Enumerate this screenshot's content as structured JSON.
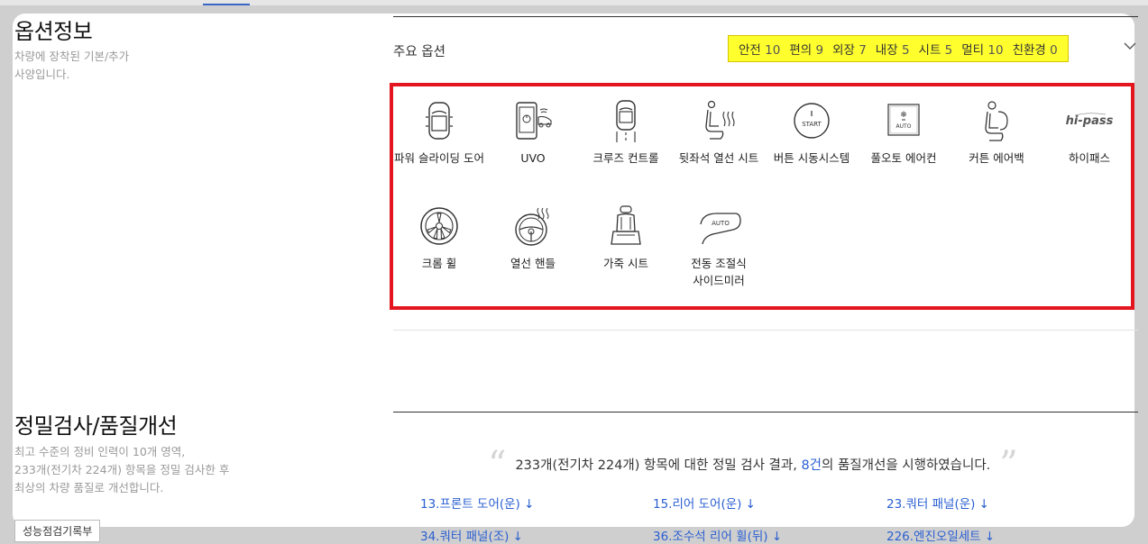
{
  "options_section": {
    "title": "옵션정보",
    "desc_line1": "차량에 장착된 기본/추가",
    "desc_line2": "사양입니다.",
    "main_label": "주요 옵션",
    "categories": [
      {
        "name": "안전",
        "count": "10"
      },
      {
        "name": "편의",
        "count": "9"
      },
      {
        "name": "외장",
        "count": "7"
      },
      {
        "name": "내장",
        "count": "5"
      },
      {
        "name": "시트",
        "count": "5"
      },
      {
        "name": "멀티",
        "count": "10"
      },
      {
        "name": "친환경",
        "count": "0"
      }
    ],
    "items": [
      {
        "label": "파워 슬라이딩 도어",
        "icon": "sliding-door-icon"
      },
      {
        "label": "UVO",
        "icon": "uvo-phone-icon"
      },
      {
        "label": "크루즈 컨트롤",
        "icon": "cruise-control-icon"
      },
      {
        "label": "뒷좌석 열선 시트",
        "icon": "heated-seat-icon"
      },
      {
        "label": "버튼 시동시스템",
        "icon": "start-button-icon",
        "icon_text": "START"
      },
      {
        "label": "풀오토 에어컨",
        "icon": "auto-aircon-icon",
        "icon_text": "AUTO"
      },
      {
        "label": "커튼 에어백",
        "icon": "curtain-airbag-icon"
      },
      {
        "label": "하이패스",
        "icon": "hipass-icon",
        "icon_text": "hi-pass"
      },
      {
        "label": "크롬 휠",
        "icon": "chrome-wheel-icon"
      },
      {
        "label": "열선 핸들",
        "icon": "heated-wheel-icon"
      },
      {
        "label": "가죽 시트",
        "icon": "leather-seat-icon"
      },
      {
        "label": "전동 조절식 사이드미러",
        "icon": "power-mirror-icon",
        "icon_text": "AUTO"
      }
    ]
  },
  "inspection_section": {
    "title": "정밀검사/품질개선",
    "desc_line1": "최고 수준의 정비 인력이 10개 영역,",
    "desc_line2": "233개(전기차 224개) 항목을 정밀 검사한 후",
    "desc_line3": "최상의 차량 품질로 개선합니다.",
    "report_button": "성능점검기록부",
    "quote_before": "233개(전기차 224개) 항목에 대한 정밀 검사 결과, ",
    "quote_highlight": "8건",
    "quote_after": "의 품질개선을 시행하였습니다.",
    "links": [
      "13.프론트 도어(운) ↓",
      "15.리어 도어(운) ↓",
      "23.쿼터 패널(운) ↓",
      "34.쿼터 패널(조) ↓",
      "36.조수석 리어 휠(뒤) ↓",
      "226.엔진오일세트 ↓"
    ]
  },
  "colors": {
    "highlight_box": "#ffff2e",
    "red_frame": "#e3161f",
    "link": "#2a5fd1"
  }
}
